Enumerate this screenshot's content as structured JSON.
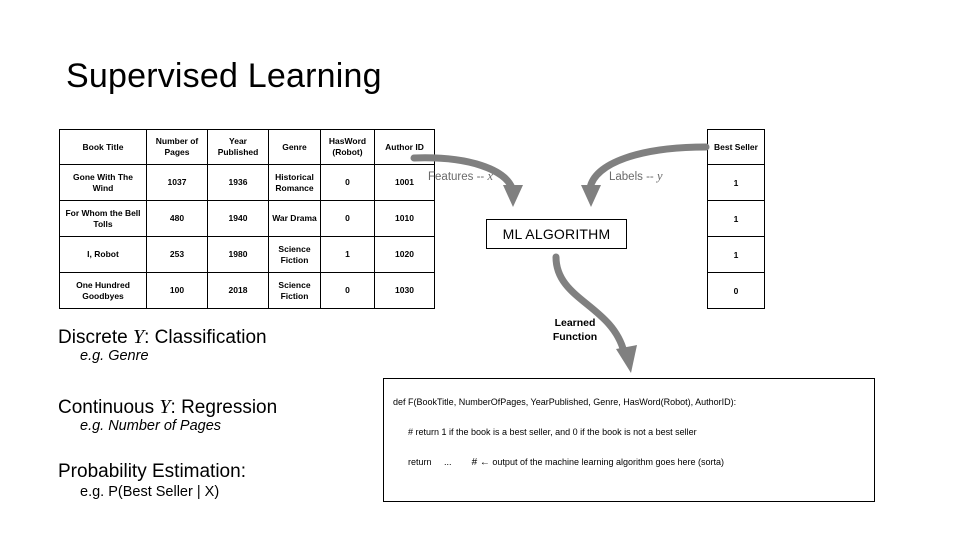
{
  "slide": {
    "title": "Supervised Learning"
  },
  "data_table": {
    "headers": [
      "Book Title",
      "Number of Pages",
      "Year Published",
      "Genre",
      "HasWord (Robot)",
      "Author ID"
    ],
    "rows": [
      {
        "book_title": "Gone With The Wind",
        "number_of_pages": "1037",
        "year_published": "1936",
        "genre": "Historical Romance",
        "has_word_robot": "0",
        "author_id": "1001"
      },
      {
        "book_title": "For Whom the Bell Tolls",
        "number_of_pages": "480",
        "year_published": "1940",
        "genre": "War Drama",
        "has_word_robot": "0",
        "author_id": "1010"
      },
      {
        "book_title": "I, Robot",
        "number_of_pages": "253",
        "year_published": "1980",
        "genre": "Science Fiction",
        "has_word_robot": "1",
        "author_id": "1020"
      },
      {
        "book_title": "One Hundred Goodbyes",
        "number_of_pages": "100",
        "year_published": "2018",
        "genre": "Science Fiction",
        "has_word_robot": "0",
        "author_id": "1030"
      }
    ]
  },
  "bestseller_table": {
    "header": "Best Seller",
    "values": [
      "1",
      "1",
      "1",
      "0"
    ]
  },
  "diagram": {
    "features_label_prefix": "Features -- ",
    "features_variable": "x",
    "labels_label_prefix": "Labels -- ",
    "labels_variable": "y",
    "ml_algorithm_box": "ML ALGORITHM",
    "learned_function_line1": "Learned",
    "learned_function_line2": "Function",
    "arrow_color": "#808080",
    "label_color": "#6a6a6a"
  },
  "bullets": {
    "classification_prefix": "Discrete ",
    "classification_variable": "Y",
    "classification_suffix": ":  Classification",
    "classification_example": "e.g. Genre",
    "regression_prefix": "Continuous ",
    "regression_variable": "Y",
    "regression_suffix": ": Regression",
    "regression_example": "e.g. Number of Pages",
    "probability_title": "Probability Estimation:",
    "probability_example": "e.g. P(Best Seller | X)"
  },
  "code": {
    "def_line": "def F(BookTitle, NumberOfPages, YearPublished, Genre, HasWord(Robot), AuthorID):",
    "comment_line": "# return 1 if the book is a best seller, and 0 if the book is not a best seller",
    "return_keyword": "return",
    "return_value": "...",
    "return_comment_arrow": "# ←",
    "return_comment": "output of the machine learning algorithm goes here (sorta)"
  }
}
